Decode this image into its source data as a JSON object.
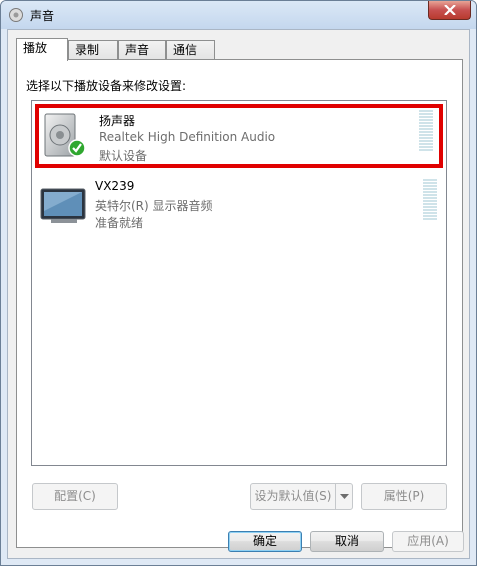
{
  "window": {
    "title": "声音"
  },
  "tabs": [
    {
      "label": "播放"
    },
    {
      "label": "录制"
    },
    {
      "label": "声音"
    },
    {
      "label": "通信"
    }
  ],
  "panel": {
    "instruction": "选择以下播放设备来修改设置:"
  },
  "devices": [
    {
      "name": "扬声器",
      "description": "Realtek High Definition Audio",
      "status": "默认设备",
      "icon": "speaker-icon",
      "selected": true
    },
    {
      "name": "VX239",
      "description": "英特尔(R) 显示器音频",
      "status": "准备就绪",
      "icon": "monitor-icon",
      "selected": false
    }
  ],
  "panel_buttons": {
    "configure": "配置(C)",
    "set_default": "设为默认值(S)",
    "properties": "属性(P)"
  },
  "dialog_buttons": {
    "ok": "确定",
    "cancel": "取消",
    "apply": "应用(A)"
  },
  "colors": {
    "selection_highlight": "#e00000",
    "check": "#2fa72f"
  }
}
